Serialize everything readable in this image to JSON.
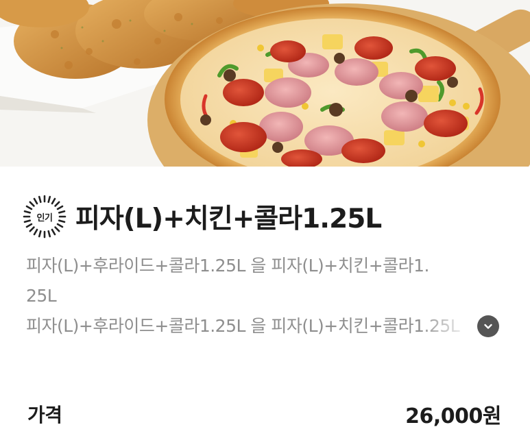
{
  "product": {
    "badge_label": "인기",
    "title": "피자(L)+치킨+콜라1.25L",
    "description_lines": [
      "피자(L)+후라이드+콜라1.25L 을 피자(L)+치킨+콜라1.",
      "25L",
      "피자(L)+후라이드+콜라1.25L 을 피자(L)+치킨+콜라1.25L"
    ],
    "expand_icon": "chevron-down-icon"
  },
  "price": {
    "label": "가격",
    "value": "26,000원"
  }
}
